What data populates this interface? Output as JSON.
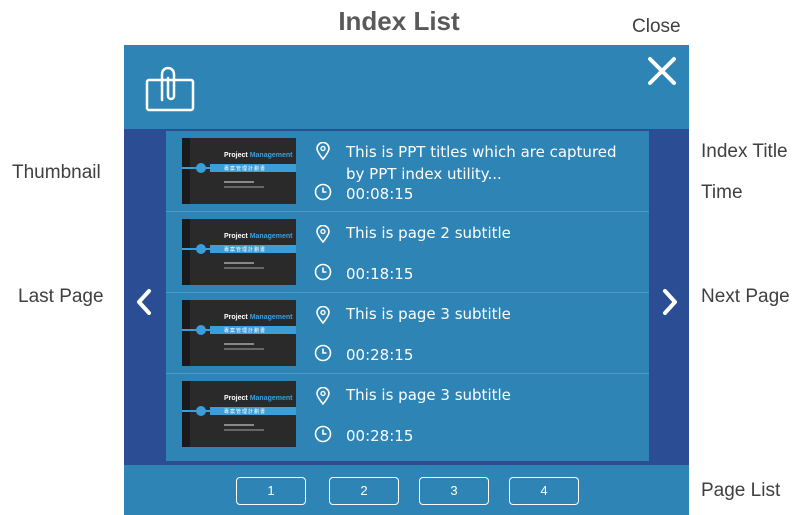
{
  "page_title": "Index List",
  "annotations": {
    "close": "Close",
    "thumbnail": "Thumbnail",
    "index_title": "Index Title",
    "time": "Time",
    "last_page": "Last Page",
    "next_page": "Next Page",
    "page_list": "Page List"
  },
  "thumbnail": {
    "title_white": "Project",
    "title_blue": "Management",
    "subtitle_glyphs": "專案管理計劃書"
  },
  "rows": [
    {
      "title": "This is PPT titles which are captured by PPT index utility...",
      "time": "00:08:15"
    },
    {
      "title": "This is page 2 subtitle",
      "time": "00:18:15"
    },
    {
      "title": "This is page 3 subtitle",
      "time": "00:28:15"
    },
    {
      "title": "This is page 3 subtitle",
      "time": "00:28:15"
    }
  ],
  "pages": [
    "1",
    "2",
    "3",
    "4"
  ],
  "icons": {
    "header": "paperclip-icon",
    "close": "close-icon",
    "title_marker": "location-pin-icon",
    "time_marker": "clock-icon",
    "prev": "chevron-left-icon",
    "next": "chevron-right-icon"
  },
  "colors": {
    "panel": "#2e84b4",
    "side": "#2a4d93",
    "text": "#ffffff",
    "title_text": "#595959"
  }
}
